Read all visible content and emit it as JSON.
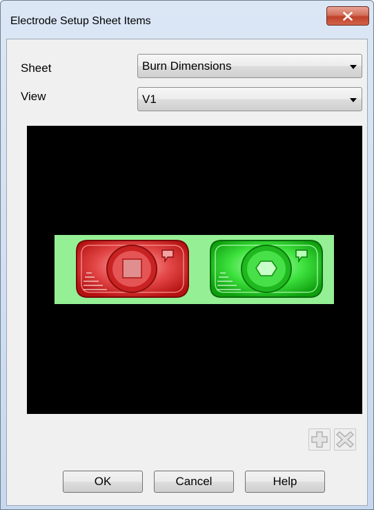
{
  "window": {
    "title": "Electrode Setup Sheet Items"
  },
  "form": {
    "sheet_label": "Sheet",
    "sheet_value": "Burn Dimensions",
    "view_label": "View",
    "view_value": "V1"
  },
  "buttons": {
    "ok": "OK",
    "cancel": "Cancel",
    "help": "Help"
  },
  "icons": {
    "close": "close-icon",
    "add": "add-icon",
    "remove": "remove-icon",
    "dropdown_arrow": "chevron-down-icon"
  },
  "colors": {
    "viewport_background": "#000000",
    "preview_strip": "#95ef95",
    "electrode_left": "#dd2a2a",
    "electrode_right": "#1fd21f"
  }
}
